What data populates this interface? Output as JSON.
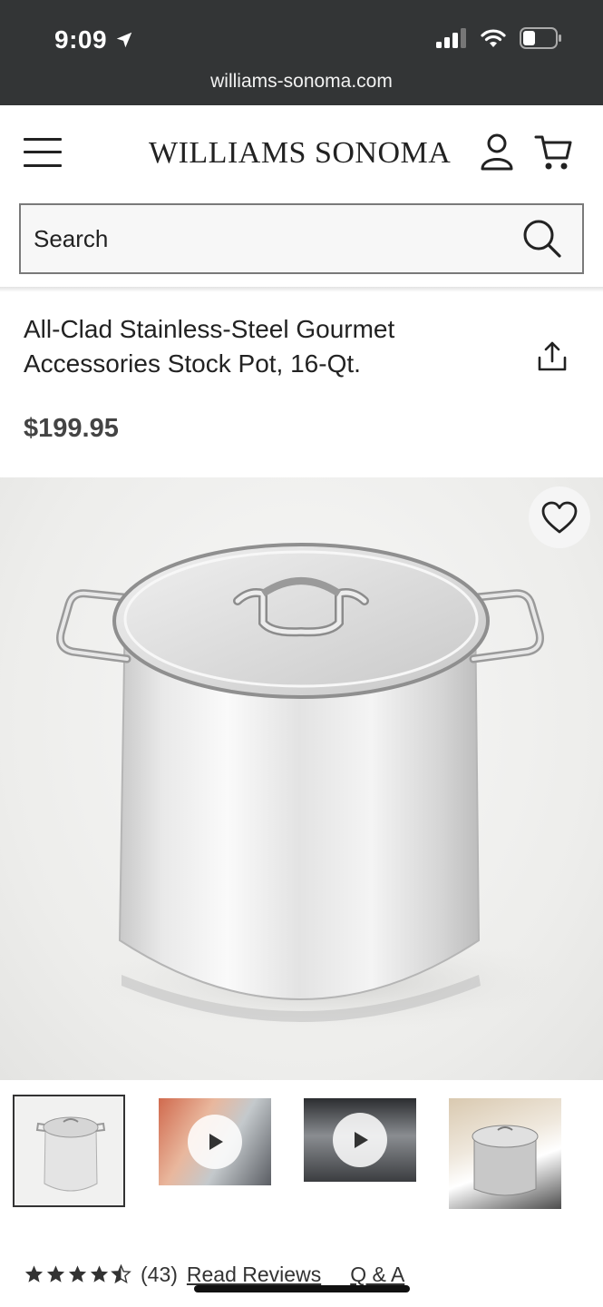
{
  "status_bar": {
    "time": "9:09",
    "url": "williams-sonoma.com"
  },
  "header": {
    "logo": "WILLIAMS SONOMA"
  },
  "search": {
    "placeholder": "Search"
  },
  "product": {
    "title": "All-Clad Stainless-Steel Gourmet Accessories Stock Pot, 16-Qt.",
    "price": "$199.95"
  },
  "thumbnails": [
    {
      "type": "image",
      "selected": true
    },
    {
      "type": "video",
      "selected": false
    },
    {
      "type": "video",
      "selected": false
    },
    {
      "type": "image",
      "selected": false
    }
  ],
  "reviews": {
    "rating": 4.5,
    "max_rating": 5,
    "count": "(43)",
    "read_reviews": "Read Reviews",
    "qa": "Q & A"
  },
  "icons": {
    "menu": "hamburger-menu-icon",
    "account": "account-icon",
    "cart": "cart-icon",
    "search": "search-icon",
    "share": "share-icon",
    "wishlist": "heart-icon",
    "play": "play-icon"
  },
  "colors": {
    "chrome": "#333536",
    "text": "#222222",
    "price": "#444444"
  }
}
